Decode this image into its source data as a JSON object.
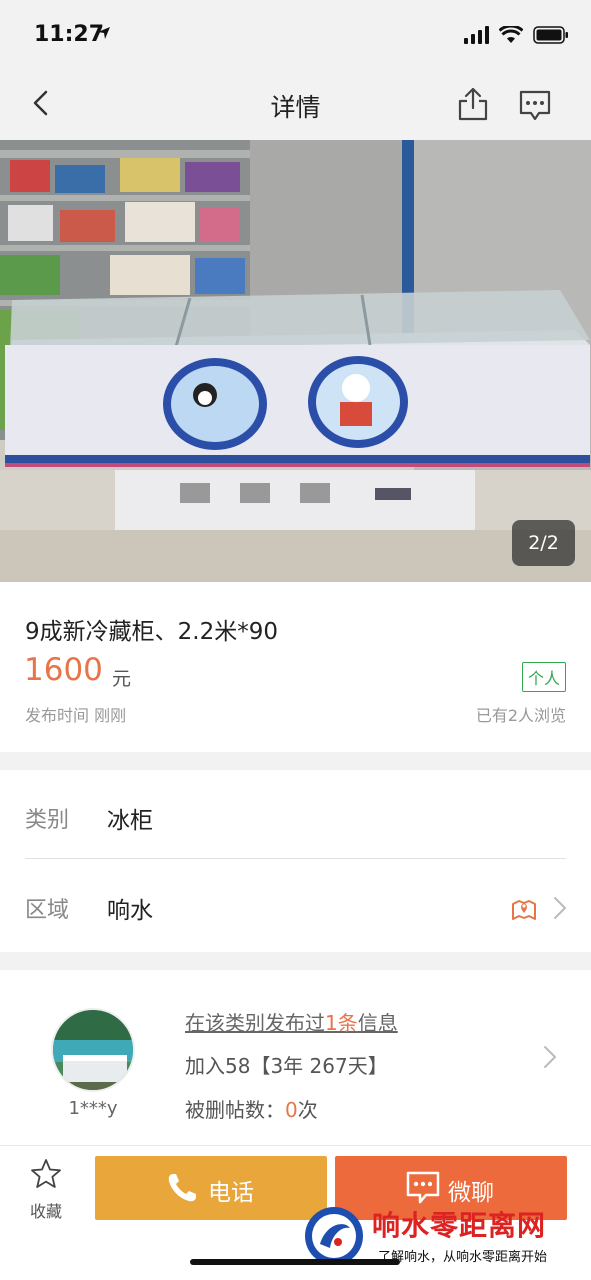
{
  "status_bar": {
    "time": "11:27"
  },
  "nav": {
    "title": "详情"
  },
  "photo": {
    "counter": "2/2"
  },
  "listing": {
    "title": "9成新冷藏柜、2.2米*90",
    "price": "1600",
    "price_unit": "元",
    "seller_type": "个人",
    "publish_time": "发布时间 刚刚",
    "views": "已有2人浏览"
  },
  "attributes": {
    "category_key": "类别",
    "category_value": "冰柜",
    "region_key": "区域",
    "region_value": "响水"
  },
  "seller": {
    "name": "1***y",
    "posted_prefix": "在该类别发布过",
    "posted_count": "1条",
    "posted_suffix": "信息",
    "joined": "加入58【3年  267天】",
    "deleted_prefix": "被删帖数：",
    "deleted_count": "0",
    "deleted_suffix": "次"
  },
  "bottom_bar": {
    "favorite_label": "收藏",
    "call_label": "电话",
    "chat_label": "微聊"
  },
  "watermark": {
    "title": "响水零距离网",
    "subtitle": "了解响水，从响水零距离开始"
  },
  "colors": {
    "accent_orange": "#e8744a",
    "call_button": "#e9a63a",
    "chat_button": "#ec6a3c",
    "badge_green": "#32a852"
  },
  "icons": [
    "navigation-arrow-icon",
    "signal-icon",
    "wifi-icon",
    "battery-icon",
    "back-icon",
    "share-icon",
    "message-icon",
    "map-pin-icon",
    "chevron-right-icon",
    "star-icon",
    "phone-icon",
    "chat-icon"
  ]
}
